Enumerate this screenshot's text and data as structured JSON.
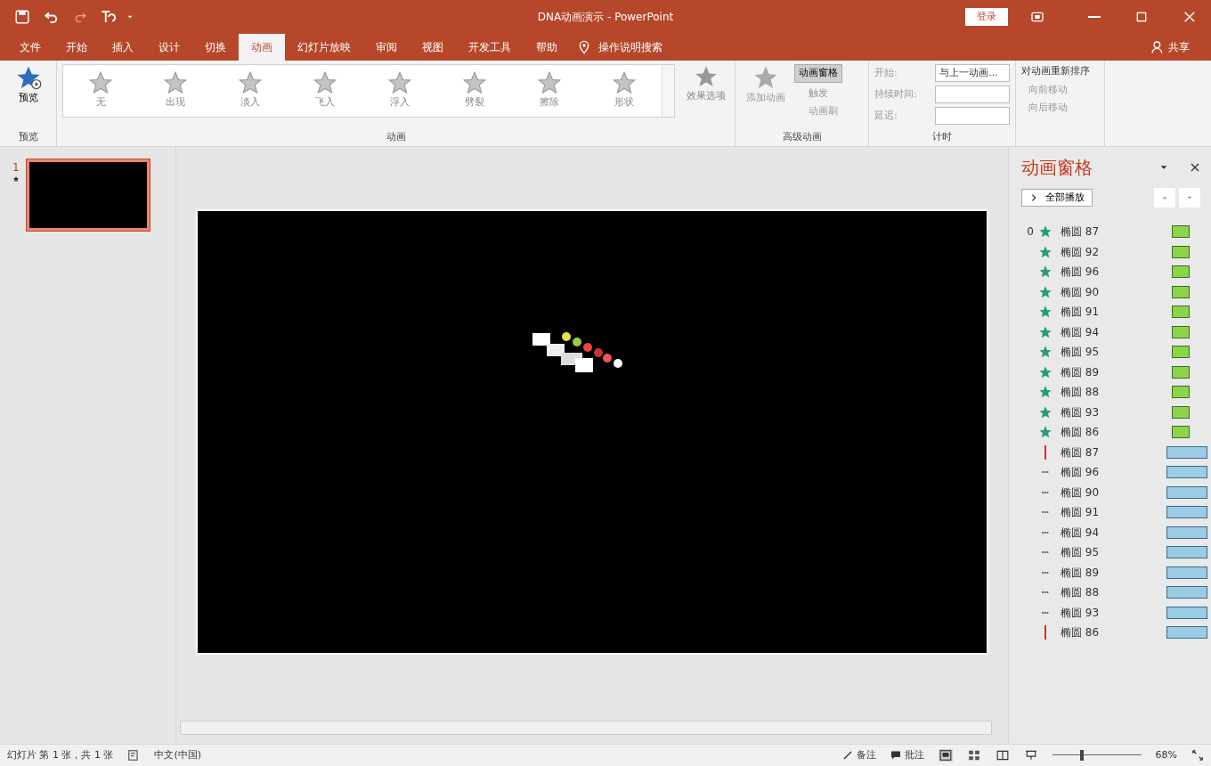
{
  "window": {
    "title": "DNA动画演示 - PowerPoint",
    "sign_in": "登录",
    "share": "共享"
  },
  "tabs": [
    {
      "label": "文件",
      "selected": false
    },
    {
      "label": "开始",
      "selected": false
    },
    {
      "label": "插入",
      "selected": false
    },
    {
      "label": "设计",
      "selected": false
    },
    {
      "label": "切换",
      "selected": false
    },
    {
      "label": "动画",
      "selected": true
    },
    {
      "label": "幻灯片放映",
      "selected": false
    },
    {
      "label": "审阅",
      "selected": false
    },
    {
      "label": "视图",
      "selected": false
    },
    {
      "label": "开发工具",
      "selected": false
    },
    {
      "label": "帮助",
      "selected": false
    }
  ],
  "tell_me": "操作说明搜索",
  "ribbon": {
    "preview": "预览",
    "preview_group": "预览",
    "gallery": [
      {
        "label": "无"
      },
      {
        "label": "出现"
      },
      {
        "label": "淡入"
      },
      {
        "label": "飞入"
      },
      {
        "label": "浮入"
      },
      {
        "label": "劈裂"
      },
      {
        "label": "擦除"
      },
      {
        "label": "形状"
      }
    ],
    "effect_options": "效果选项",
    "animation_group": "动画",
    "add_animation": "添加动画",
    "animation_pane_button": {
      "label": "动画窗格",
      "selected": true
    },
    "trigger": "触发",
    "painter": "动画刷",
    "advanced_group": "高级动画",
    "start_label": "开始:",
    "start_value": "与上一动画...",
    "duration_label": "持续时间:",
    "delay_label": "延迟:",
    "timing_group": "计时",
    "reorder_title": "对动画重新排序",
    "move_earlier": "向前移动",
    "move_later": "向后移动"
  },
  "thumbnails": [
    {
      "number": "1",
      "selected": true
    }
  ],
  "pane": {
    "title": "动画窗格",
    "play_all": "全部播放",
    "items": [
      {
        "label": "椭圆 87",
        "kind": "star",
        "trigger": "0"
      },
      {
        "label": "椭圆 92",
        "kind": "star"
      },
      {
        "label": "椭圆 96",
        "kind": "star"
      },
      {
        "label": "椭圆 90",
        "kind": "star"
      },
      {
        "label": "椭圆 91",
        "kind": "star"
      },
      {
        "label": "椭圆 94",
        "kind": "star"
      },
      {
        "label": "椭圆 95",
        "kind": "star"
      },
      {
        "label": "椭圆 89",
        "kind": "star"
      },
      {
        "label": "椭圆 88",
        "kind": "star"
      },
      {
        "label": "椭圆 93",
        "kind": "star"
      },
      {
        "label": "椭圆 86",
        "kind": "star"
      },
      {
        "label": "椭圆 87",
        "kind": "vpath"
      },
      {
        "label": "椭圆 96",
        "kind": "hpath"
      },
      {
        "label": "椭圆 90",
        "kind": "hpath"
      },
      {
        "label": "椭圆 91",
        "kind": "hpath"
      },
      {
        "label": "椭圆 94",
        "kind": "hpath"
      },
      {
        "label": "椭圆 95",
        "kind": "hpath"
      },
      {
        "label": "椭圆 89",
        "kind": "hpath"
      },
      {
        "label": "椭圆 88",
        "kind": "hpath"
      },
      {
        "label": "椭圆 93",
        "kind": "hpath"
      },
      {
        "label": "椭圆 86",
        "kind": "vpath"
      }
    ]
  },
  "status_bar": {
    "slide_info": "幻灯片 第 1 张，共 1 张",
    "language": "中文(中国)",
    "notes": "备注",
    "comments": "批注",
    "zoom": "68%",
    "zoom_slider": {
      "level": 0.33
    }
  }
}
